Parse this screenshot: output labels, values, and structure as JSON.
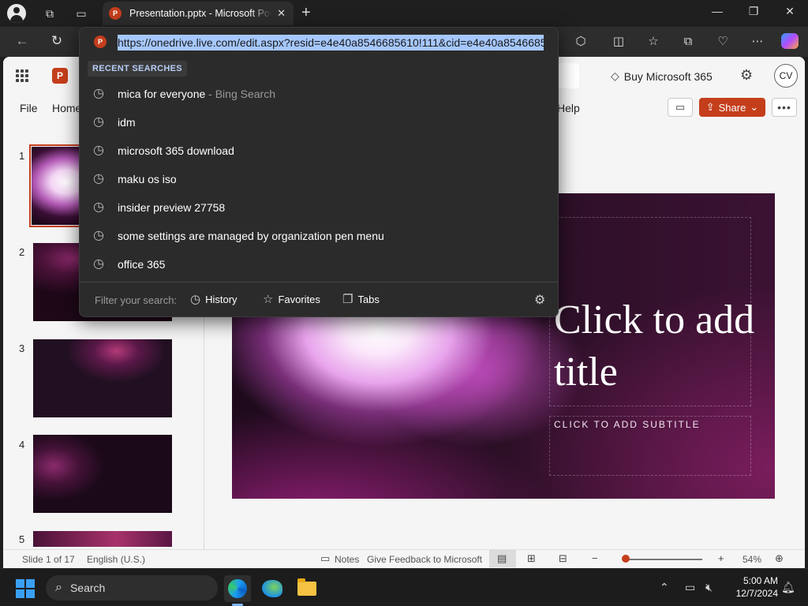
{
  "browser": {
    "tab_title": "Presentation.pptx - Microsoft PowerPoint",
    "tab_favicon": "P",
    "address_url": "https://onedrive.live.com/edit.aspx?resid=e4e40a8546685610!111&cid=e4e40a8546685"
  },
  "omnibox": {
    "heading": "RECENT SEARCHES",
    "suggestions": [
      {
        "text": "mica for everyone",
        "hint": " - Bing Search"
      },
      {
        "text": "idm",
        "hint": ""
      },
      {
        "text": "microsoft 365 download",
        "hint": ""
      },
      {
        "text": "maku os iso",
        "hint": ""
      },
      {
        "text": "insider preview 27758",
        "hint": ""
      },
      {
        "text": "some settings are managed by organization pen menu",
        "hint": ""
      },
      {
        "text": "office 365",
        "hint": ""
      }
    ],
    "filter_label": "Filter your search:",
    "filters": [
      "History",
      "Favorites",
      "Tabs"
    ]
  },
  "app": {
    "logo_letter": "P",
    "buy_label": "Buy Microsoft 365",
    "avatar_initials": "CV",
    "ribbon_tabs": [
      "File",
      "Home",
      "Help"
    ],
    "share_label": "Share"
  },
  "thumbnails": [
    {
      "num": "1"
    },
    {
      "num": "2"
    },
    {
      "num": "3"
    },
    {
      "num": "4"
    },
    {
      "num": "5"
    }
  ],
  "slide": {
    "title": "Click to add title",
    "subtitle": "CLICK TO ADD SUBTITLE"
  },
  "status": {
    "slide_info": "Slide 1 of 17",
    "language": "English (U.S.)",
    "notes": "Notes",
    "feedback": "Give Feedback to Microsoft",
    "zoom": "54%",
    "zoom_fraction": 0.04
  },
  "taskbar": {
    "search_label": "Search",
    "time": "5:00 AM",
    "date": "12/7/2024"
  },
  "colors": {
    "accent": "#c43e1c",
    "url_selection": "#a6c8ff",
    "windows_blue": "#3aa0f3"
  }
}
